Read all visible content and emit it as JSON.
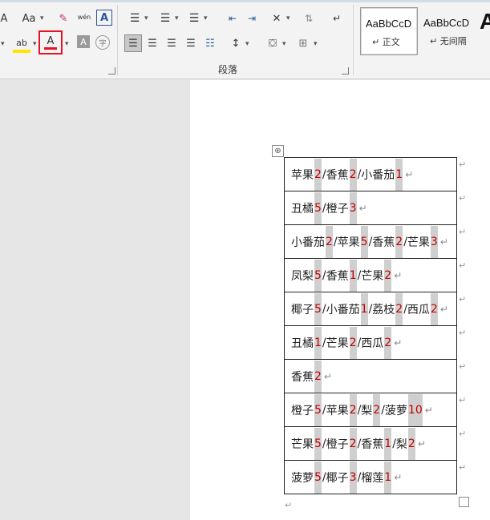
{
  "ribbon": {
    "font_group": {
      "size_up": "A",
      "change_case": "Aa",
      "clear_format": "✎",
      "phonetic": "wén",
      "char_border": "A",
      "highlight": "ab",
      "font_color": "A",
      "char_shading": "A",
      "enclose": "字"
    },
    "paragraph_group": {
      "label": "段落"
    },
    "styles": [
      {
        "sample": "AaBbCcD",
        "name": "↵ 正文"
      },
      {
        "sample": "AaBbCcD",
        "name": "↵ 无间隔"
      },
      {
        "sample": "A",
        "name": ""
      }
    ],
    "colors": {
      "accent": "#2b579a",
      "font_color_highlight": "#e81123"
    }
  },
  "document": {
    "table_move_icon": "⊕",
    "rows": [
      [
        [
          "苹果",
          "2"
        ],
        [
          "香蕉",
          "2"
        ],
        [
          "小番茄",
          "1"
        ]
      ],
      [
        [
          "丑橘",
          "5"
        ],
        [
          "橙子",
          "3"
        ]
      ],
      [
        [
          "小番茄",
          "2"
        ],
        [
          "苹果",
          "5"
        ],
        [
          "香蕉",
          "2"
        ],
        [
          "芒果",
          "3"
        ]
      ],
      [
        [
          "凤梨",
          "5"
        ],
        [
          "香蕉",
          "1"
        ],
        [
          "芒果",
          "2"
        ]
      ],
      [
        [
          "椰子",
          "5"
        ],
        [
          "小番茄",
          "1"
        ],
        [
          "荔枝",
          "2"
        ],
        [
          "西瓜",
          "2"
        ]
      ],
      [
        [
          "丑橘",
          "1"
        ],
        [
          "芒果",
          "2"
        ],
        [
          "西瓜",
          "2"
        ]
      ],
      [
        [
          "香蕉",
          "2"
        ]
      ],
      [
        [
          "橙子",
          "5"
        ],
        [
          "苹果",
          "2"
        ],
        [
          "梨",
          "2"
        ],
        [
          "菠萝",
          "10"
        ]
      ],
      [
        [
          "芒果",
          "5"
        ],
        [
          "橙子",
          "2"
        ],
        [
          "香蕉",
          "1"
        ],
        [
          "梨",
          "2"
        ]
      ],
      [
        [
          "菠萝",
          "5"
        ],
        [
          "椰子",
          "3"
        ],
        [
          "榴莲",
          "1"
        ]
      ]
    ],
    "cell_mark": "↵",
    "separator": "/",
    "number_color": "#c00000"
  }
}
